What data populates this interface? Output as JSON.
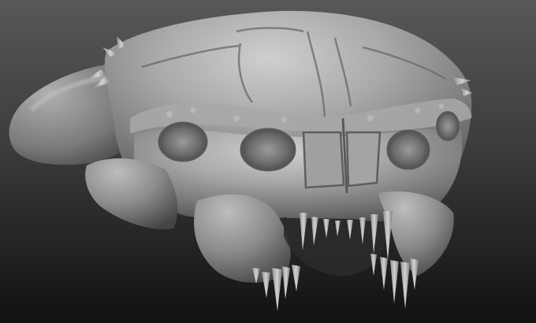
{
  "scene": {
    "subject": "sculpted-creature-skull",
    "background_top": "#565656",
    "background_bottom": "#121212",
    "material_light": "#b5b5b5",
    "material_mid": "#8b8b8b",
    "material_shadow": "#3a3a3a",
    "fang_color": "#c8c8c8"
  }
}
